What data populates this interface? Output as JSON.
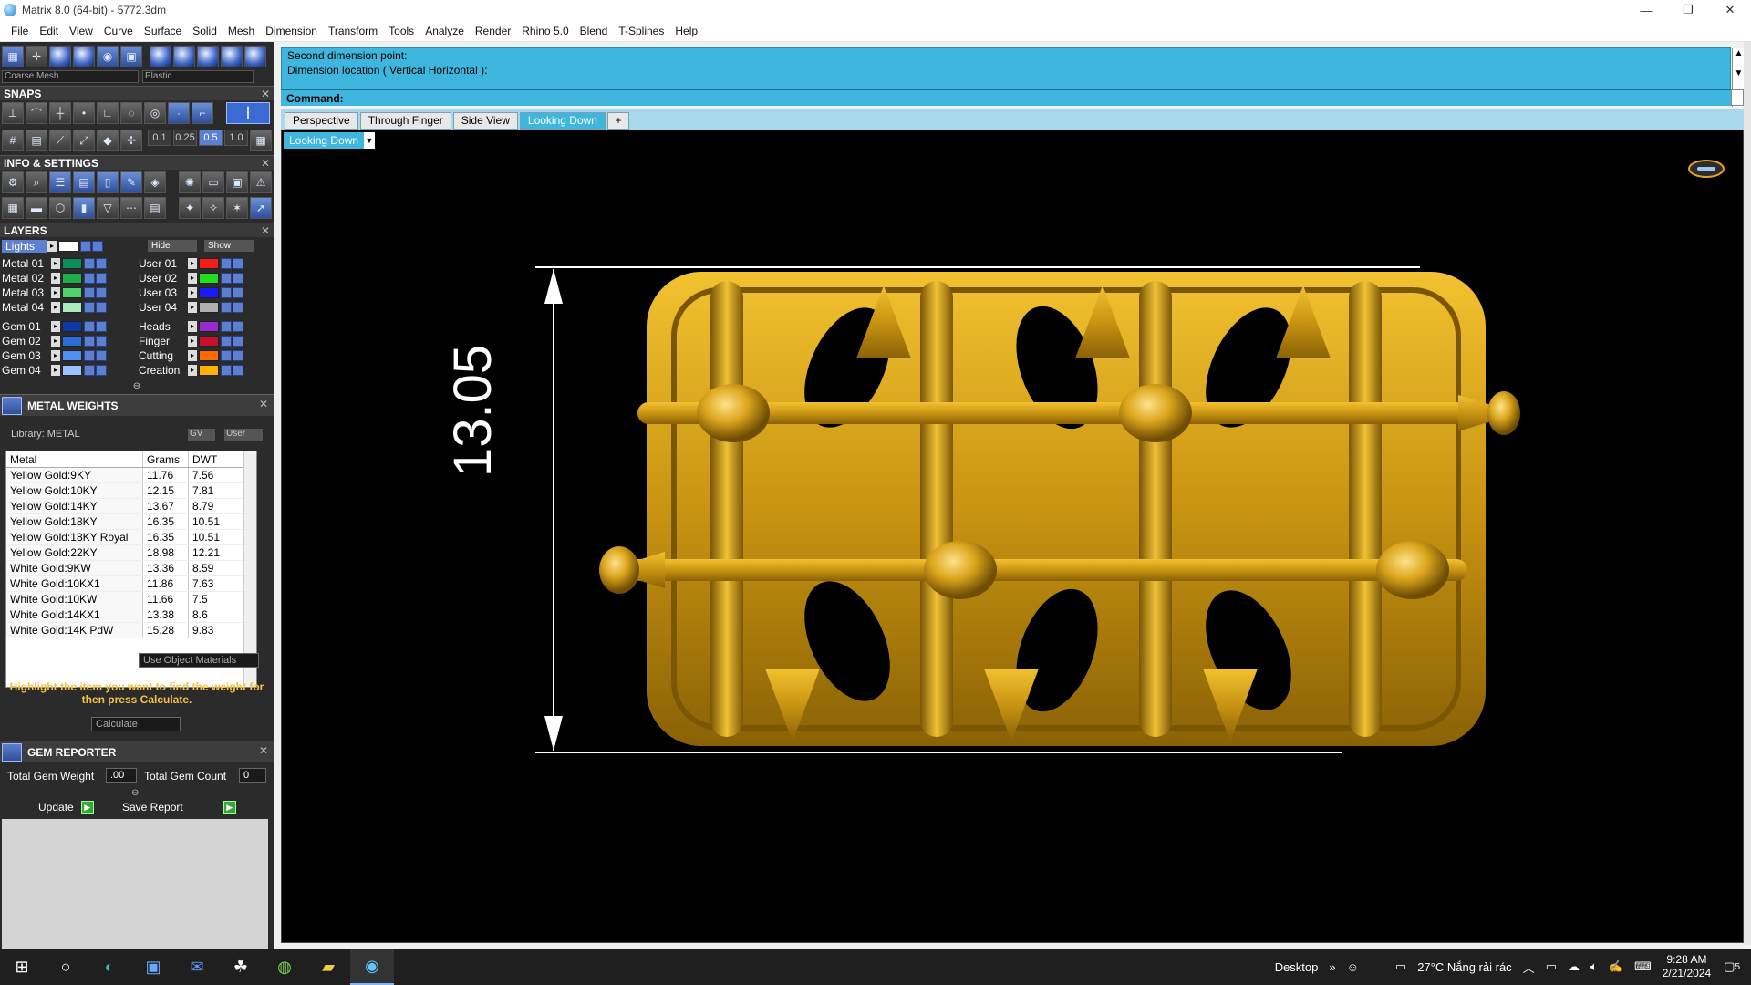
{
  "window": {
    "title": "Matrix 8.0 (64-bit) - 5772.3dm",
    "minimize": "—",
    "restore": "❐",
    "close": "✕"
  },
  "menu": [
    "File",
    "Edit",
    "View",
    "Curve",
    "Surface",
    "Solid",
    "Mesh",
    "Dimension",
    "Transform",
    "Tools",
    "Analyze",
    "Render",
    "Rhino 5.0",
    "Blend",
    "T-Splines",
    "Help"
  ],
  "toolbar": {
    "mesh_quality": "Coarse Mesh",
    "material": "Plastic"
  },
  "snaps": {
    "header": "SNAPS",
    "values": [
      "0.1",
      "0.25",
      "0.5",
      "1.0"
    ],
    "selected": "0.5"
  },
  "info_settings": {
    "header": "INFO & SETTINGS"
  },
  "layers": {
    "header": "LAYERS",
    "lights_label": "Lights",
    "hide_label": "Hide",
    "show_label": "Show",
    "left": [
      {
        "name": "Metal 01",
        "color": "#0a8f5a"
      },
      {
        "name": "Metal 02",
        "color": "#1fae4b"
      },
      {
        "name": "Metal 03",
        "color": "#4fd36a"
      },
      {
        "name": "Metal 04",
        "color": "#a8ecb8"
      },
      {
        "name": "Gem 01",
        "color": "#0a3aa8"
      },
      {
        "name": "Gem 02",
        "color": "#2a6fd8"
      },
      {
        "name": "Gem 03",
        "color": "#4e8ff0"
      },
      {
        "name": "Gem 04",
        "color": "#9cc2ff"
      }
    ],
    "right": [
      {
        "name": "User 01",
        "color": "#ff1a1a"
      },
      {
        "name": "User 02",
        "color": "#22dd22"
      },
      {
        "name": "User 03",
        "color": "#1a1aff"
      },
      {
        "name": "User 04",
        "color": "#b0b0b0"
      },
      {
        "name": "Heads",
        "color": "#9a2ad0"
      },
      {
        "name": "Finger",
        "color": "#c8102e"
      },
      {
        "name": "Cutting",
        "color": "#ff6a00"
      },
      {
        "name": "Creation",
        "color": "#ffb000"
      }
    ]
  },
  "metal_weights": {
    "header": "METAL WEIGHTS",
    "library_label": "Library: METAL",
    "gv_label": "GV",
    "user_label": "User",
    "columns": [
      "Metal",
      "Grams",
      "DWT"
    ],
    "rows": [
      [
        "Yellow Gold:9KY",
        "11.76",
        "7.56"
      ],
      [
        "Yellow Gold:10KY",
        "12.15",
        "7.81"
      ],
      [
        "Yellow Gold:14KY",
        "13.67",
        "8.79"
      ],
      [
        "Yellow Gold:18KY",
        "16.35",
        "10.51"
      ],
      [
        "Yellow Gold:18KY Royal",
        "16.35",
        "10.51"
      ],
      [
        "Yellow Gold:22KY",
        "18.98",
        "12.21"
      ],
      [
        "White Gold:9KW",
        "13.36",
        "8.59"
      ],
      [
        "White Gold:10KX1",
        "11.86",
        "7.63"
      ],
      [
        "White Gold:10KW",
        "11.66",
        "7.5"
      ],
      [
        "White Gold:14KX1",
        "13.38",
        "8.6"
      ],
      [
        "White Gold:14K PdW",
        "15.28",
        "9.83"
      ]
    ],
    "use_object_materials": "Use Object Materials",
    "hint": "Highlight the item you want to find the weight for then press Calculate.",
    "calculate": "Calculate"
  },
  "gem_reporter": {
    "header": "GEM REPORTER",
    "total_weight_label": "Total Gem Weight",
    "total_weight_value": ".00",
    "total_count_label": "Total Gem Count",
    "total_count_value": "0",
    "update": "Update",
    "save_report": "Save Report"
  },
  "command": {
    "line1": "Second dimension point:",
    "line2": "Dimension location ( Vertical  Horizontal ):",
    "prompt": "Command:"
  },
  "viewport_tabs": [
    "Perspective",
    "Through Finger",
    "Side View",
    "Looking Down",
    "+"
  ],
  "active_tab": "Looking Down",
  "viewport": {
    "dropdown": "Looking Down",
    "dimension": "13.05",
    "model_color": "#d4a017"
  },
  "taskbar": {
    "desktop": "Desktop",
    "weather": "27°C  Nắng rải rác",
    "time": "9:28 AM",
    "date": "2/21/2024",
    "notifications": "5"
  }
}
